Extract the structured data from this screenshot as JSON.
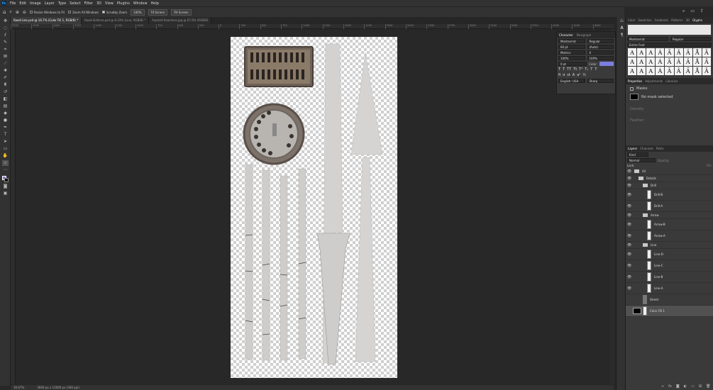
{
  "menubar": {
    "logo": "Ps",
    "items": [
      "File",
      "Edit",
      "Image",
      "Layer",
      "Type",
      "Select",
      "Filter",
      "3D",
      "View",
      "Plugins",
      "Window",
      "Help"
    ]
  },
  "options": {
    "resize_windows": "Resize Windows to Fit",
    "zoom_all": "Zoom All Windows",
    "scrubby_zoom": "Scrubby Zoom",
    "zoom_pct": "100%",
    "fit_screen": "Fit Screen",
    "fill_screen": "Fill Screen"
  },
  "tabs": [
    "Road-Line.psd @ 16.7% (Color Fill 1, RGB/8) *",
    "Road-Sideline.psd @ 8.33% (Line, RGB/8) *",
    "Asphalt-Seamless.jpg @ 67.6% (RGB/8)"
  ],
  "ruler_ticks": [
    "2500",
    "2250",
    "2000",
    "1750",
    "1500",
    "1250",
    "1000",
    "750",
    "500",
    "250",
    "0",
    "250",
    "500",
    "750",
    "1000",
    "1250",
    "1500",
    "1750",
    "2000",
    "2250",
    "2500",
    "2750",
    "3000",
    "3250",
    "3500",
    "3750",
    "4000",
    "4250",
    "4500"
  ],
  "status": {
    "zoom": "16.67%",
    "doc": "3000 px x 12000 px (300 ppi)"
  },
  "character": {
    "tabs": [
      "Character",
      "Paragraph"
    ],
    "font": "Montserrat",
    "style": "Regular",
    "size": "60 pt",
    "leading": "(Auto)",
    "kerning": "Metrics",
    "tracking": "0",
    "vscale": "100%",
    "hscale": "100%",
    "baseline": "0 pt",
    "color_label": "Color:",
    "lang": "English: USA",
    "aa": "Sharp"
  },
  "right_tabs": [
    "Color",
    "Swatches",
    "Gradients",
    "Patterns",
    "3D",
    "Glyphs"
  ],
  "glyphs": {
    "font": "Montserrat",
    "style": "Regular",
    "filter": "Entire Font",
    "chars": [
      "A",
      "A",
      "A",
      "Á",
      "Ã",
      "Â",
      "Ä",
      "Å",
      "Ā",
      "A",
      "A",
      "A",
      "Á",
      "Ã",
      "Â",
      "Ä",
      "Å",
      "Ā",
      "A",
      "A",
      "A",
      "Á",
      "Ã",
      "Â",
      "Ä",
      "Å",
      "Ā"
    ]
  },
  "properties": {
    "tabs": [
      "Properties",
      "Adjustments",
      "Libraries"
    ],
    "masks": "Masks",
    "no_mask": "No mask selected",
    "density": "Density:",
    "feather": "Feather:"
  },
  "layers": {
    "tabs": [
      "Layers",
      "Channels",
      "Paths"
    ],
    "kind": "Kind",
    "blend": "Normal",
    "opacity": "Opacity:",
    "lock": "Lock:",
    "fill": "Fill:",
    "items": [
      {
        "name": "All",
        "type": "group"
      },
      {
        "name": "Details",
        "type": "group"
      },
      {
        "name": "Drill",
        "type": "group"
      },
      {
        "name": "Drill-B",
        "type": "layer"
      },
      {
        "name": "Drill-A",
        "type": "layer"
      },
      {
        "name": "Arrow",
        "type": "group"
      },
      {
        "name": "Arrow-B",
        "type": "layer"
      },
      {
        "name": "Arrow-A",
        "type": "layer"
      },
      {
        "name": "Line",
        "type": "group"
      },
      {
        "name": "Line-D",
        "type": "layer"
      },
      {
        "name": "Line-C",
        "type": "layer"
      },
      {
        "name": "Line-B",
        "type": "layer"
      },
      {
        "name": "Line-A",
        "type": "layer"
      },
      {
        "name": "Street",
        "type": "layer"
      },
      {
        "name": "Color Fill 1",
        "type": "fill"
      }
    ]
  },
  "colors": {
    "foreground": "#7b7ee0",
    "text_swatch": "#7b7ee0"
  }
}
